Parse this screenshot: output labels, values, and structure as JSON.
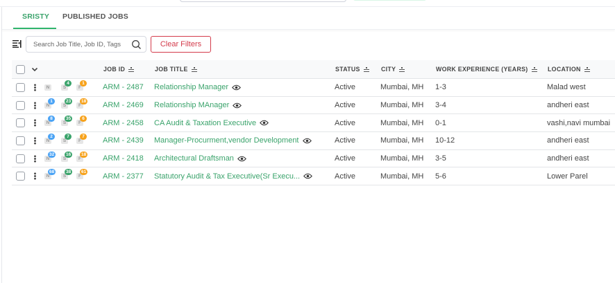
{
  "tabs": [
    {
      "label": "SRISTY",
      "active": true
    },
    {
      "label": "PUBLISHED JOBS",
      "active": false
    }
  ],
  "search": {
    "placeholder": "Search Job Title, Job ID, Tags"
  },
  "clear_filters": "Clear Filters",
  "columns": {
    "job_id": "JOB ID",
    "job_title": "JOB TITLE",
    "status": "STATUS",
    "city": "CITY",
    "experience": "WORK EXPERIENCE (YEARS)",
    "location": "LOCATION"
  },
  "badge_letters": {
    "n": "N",
    "s": "S",
    "f": "F"
  },
  "colors": {
    "accent": "#3aa36b",
    "danger": "#d33a4a",
    "n_badge": "#4aa3f5",
    "f_badge": "#f7a21b"
  },
  "rows": [
    {
      "n": "",
      "s": "4",
      "f": "1",
      "job_id": "ARM - 2487",
      "title": "Relationship Manager",
      "status": "Active",
      "city": "Mumbai, MH",
      "exp": "1-3",
      "location": "Malad west"
    },
    {
      "n": "1",
      "s": "23",
      "f": "18",
      "job_id": "ARM - 2469",
      "title": "Relationship MAnager",
      "status": "Active",
      "city": "Mumbai, MH",
      "exp": "3-4",
      "location": "andheri east"
    },
    {
      "n": "8",
      "s": "35",
      "f": "6",
      "job_id": "ARM - 2458",
      "title": "CA Audit & Taxation Executive",
      "status": "Active",
      "city": "Mumbai, MH",
      "exp": "0-1",
      "location": "vashi,navi mumbai"
    },
    {
      "n": "2",
      "s": "7",
      "f": "7",
      "job_id": "ARM - 2439",
      "title": "Manager-Procurment,vendor Development",
      "status": "Active",
      "city": "Mumbai, MH",
      "exp": "10-12",
      "location": "andheri east"
    },
    {
      "n": "32",
      "s": "16",
      "f": "18",
      "job_id": "ARM - 2418",
      "title": "Architectural Draftsman",
      "status": "Active",
      "city": "Mumbai, MH",
      "exp": "3-5",
      "location": "andheri east"
    },
    {
      "n": "68",
      "s": "38",
      "f": "61",
      "job_id": "ARM - 2377",
      "title": "Statutory Audit & Tax Executive(Sr Execu...",
      "status": "Active",
      "city": "Mumbai, MH",
      "exp": "5-6",
      "location": "Lower Parel"
    }
  ]
}
